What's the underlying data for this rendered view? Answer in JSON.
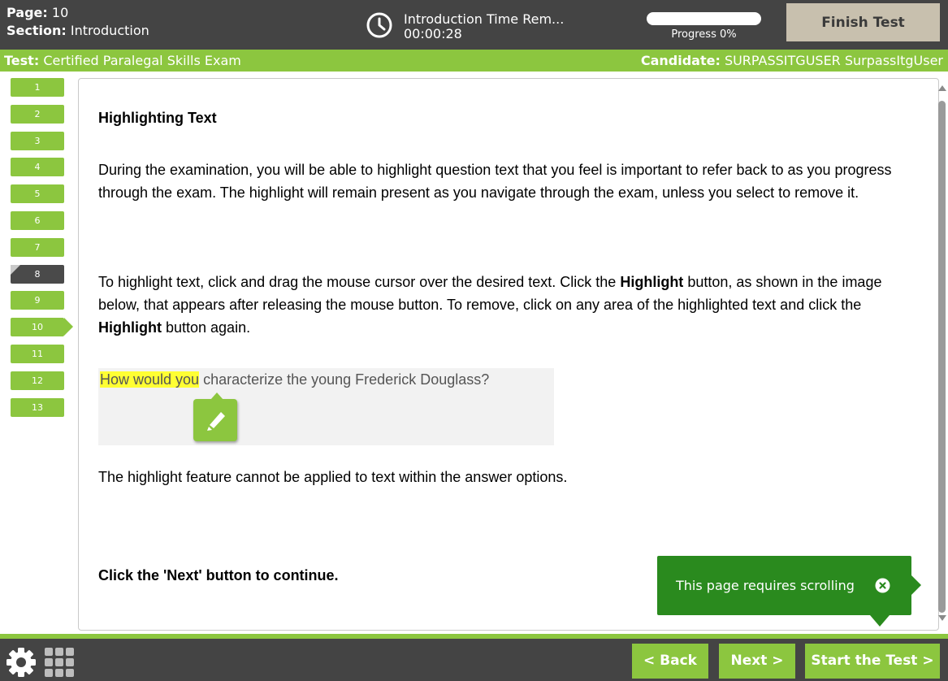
{
  "header": {
    "page_label": "Page:",
    "page_value": "10",
    "section_label": "Section:",
    "section_value": "Introduction",
    "timer_title": "Introduction Time Rem...",
    "timer_value": "00:00:28",
    "progress_label": "Progress 0%",
    "progress_fraction": 0,
    "finish_label": "Finish Test",
    "clock_icon": "clock-icon"
  },
  "infobar": {
    "test_label": "Test:",
    "test_value": "Certified Paralegal Skills Exam",
    "candidate_label": "Candidate:",
    "candidate_value": "SURPASSITGUSER SurpassItgUser"
  },
  "navigator": {
    "items": [
      {
        "label": "1",
        "state": "answered"
      },
      {
        "label": "2",
        "state": "answered"
      },
      {
        "label": "3",
        "state": "answered"
      },
      {
        "label": "4",
        "state": "answered"
      },
      {
        "label": "5",
        "state": "answered"
      },
      {
        "label": "6",
        "state": "answered"
      },
      {
        "label": "7",
        "state": "answered"
      },
      {
        "label": "8",
        "state": "viewed"
      },
      {
        "label": "9",
        "state": "answered"
      },
      {
        "label": "10",
        "state": "current"
      },
      {
        "label": "11",
        "state": "answered"
      },
      {
        "label": "12",
        "state": "answered"
      },
      {
        "label": "13",
        "state": "answered"
      }
    ]
  },
  "content": {
    "heading": "Highlighting Text",
    "para1": "During the examination, you will be able to highlight question text that you feel is important to refer back to as you progress through the exam. The highlight will remain present as you navigate through the exam, unless you select to remove it.",
    "para2_a": "To highlight text, click and drag the mouse cursor over the desired text. Click the ",
    "para2_b": "Highlight",
    "para2_c": " button, as shown in the image below, that appears after releasing the mouse button. To remove, click on any area of the highlighted text and click the ",
    "para2_d": "Highlight",
    "para2_e": " button again.",
    "demo_highlighted": "How would you",
    "demo_rest": " characterize the young Frederick Douglass?",
    "para3": "The highlight feature cannot be applied to text within the answer options.",
    "continue": "Click the 'Next' button to continue."
  },
  "notice": {
    "text": "This page requires scrolling"
  },
  "footer": {
    "back_label": "< Back",
    "next_label": "Next >",
    "start_label": "Start the Test >"
  },
  "colors": {
    "accent_green": "#8cc63f",
    "notice_green": "#2a8a1e",
    "dark_bar": "#444444",
    "finish_button": "#c8c0ae",
    "highlight_yellow": "#ffff33"
  }
}
